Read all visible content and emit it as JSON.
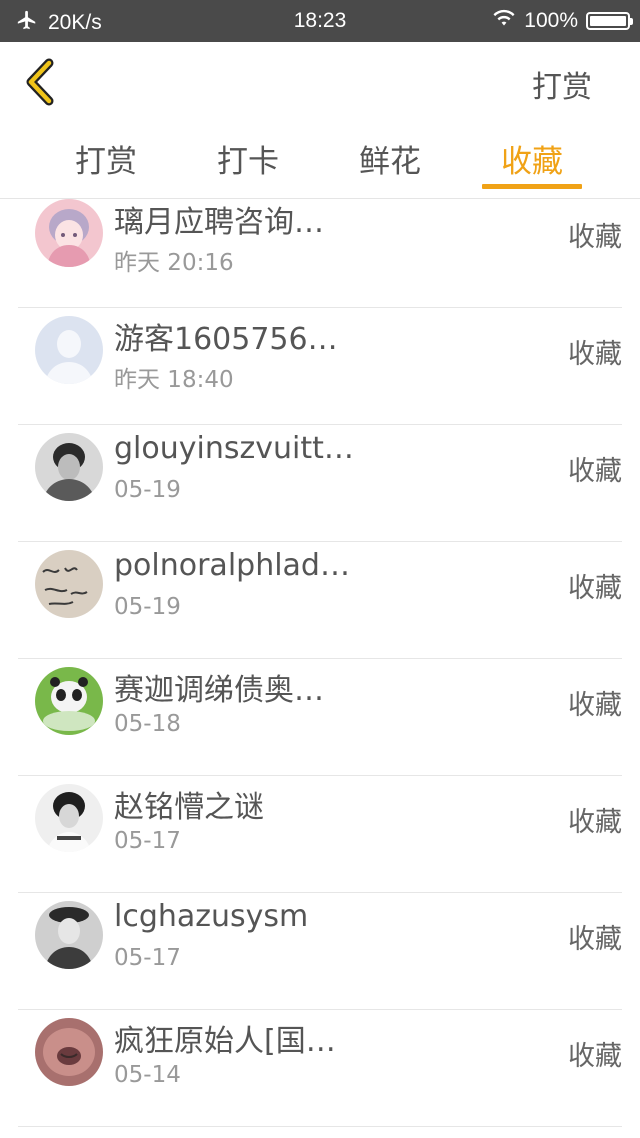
{
  "status_bar": {
    "speed": "20K/s",
    "time": "18:23",
    "battery": "100%"
  },
  "navbar": {
    "title": "打赏"
  },
  "tabs": [
    {
      "label": "打赏",
      "active": false
    },
    {
      "label": "打卡",
      "active": false
    },
    {
      "label": "鲜花",
      "active": false
    },
    {
      "label": "收藏",
      "active": true
    }
  ],
  "accent_color": "#f0a216",
  "list": [
    {
      "name": "璃月应聘咨询…",
      "date": "昨天 20:16",
      "action": "收藏"
    },
    {
      "name": "游客1605756…",
      "date": "昨天 18:40",
      "action": "收藏"
    },
    {
      "name": "glouyinszvuitt…",
      "date": "05-19",
      "action": "收藏"
    },
    {
      "name": "polnoralphlad…",
      "date": "05-19",
      "action": "收藏"
    },
    {
      "name": "赛迦调绨债奥…",
      "date": "05-18",
      "action": "收藏"
    },
    {
      "name": "赵铭懵之谜",
      "date": "05-17",
      "action": "收藏"
    },
    {
      "name": "lcghazusysm",
      "date": "05-17",
      "action": "收藏"
    },
    {
      "name": "疯狂原始人[国…",
      "date": "05-14",
      "action": "收藏"
    }
  ]
}
